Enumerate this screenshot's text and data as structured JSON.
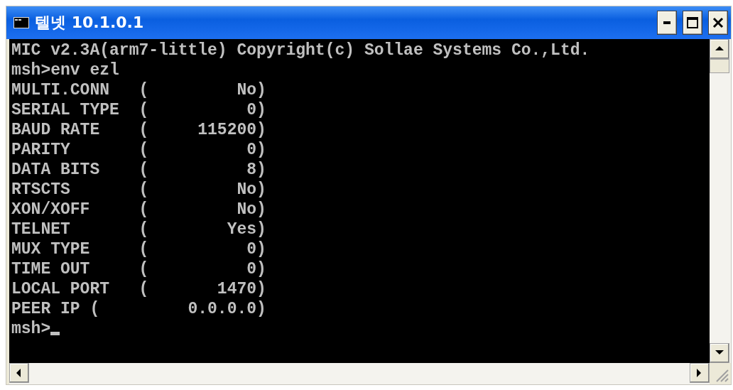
{
  "window": {
    "title": "텔넷 10.1.0.1"
  },
  "terminal": {
    "lines": [
      "MIC v2.3A(arm7-little) Copyright(c) Sollae Systems Co.,Ltd.",
      "msh>env ezl",
      "MULTI.CONN   (         No)",
      "SERIAL TYPE  (          0)",
      "BAUD RATE    (     115200)",
      "PARITY       (          0)",
      "DATA BITS    (          8)",
      "RTSCTS       (         No)",
      "XON/XOFF     (         No)",
      "TELNET       (        Yes)",
      "MUX TYPE     (          0)",
      "TIME OUT     (          0)",
      "LOCAL PORT   (       1470)",
      "PEER IP (         0.0.0.0)"
    ],
    "prompt": "msh>"
  }
}
